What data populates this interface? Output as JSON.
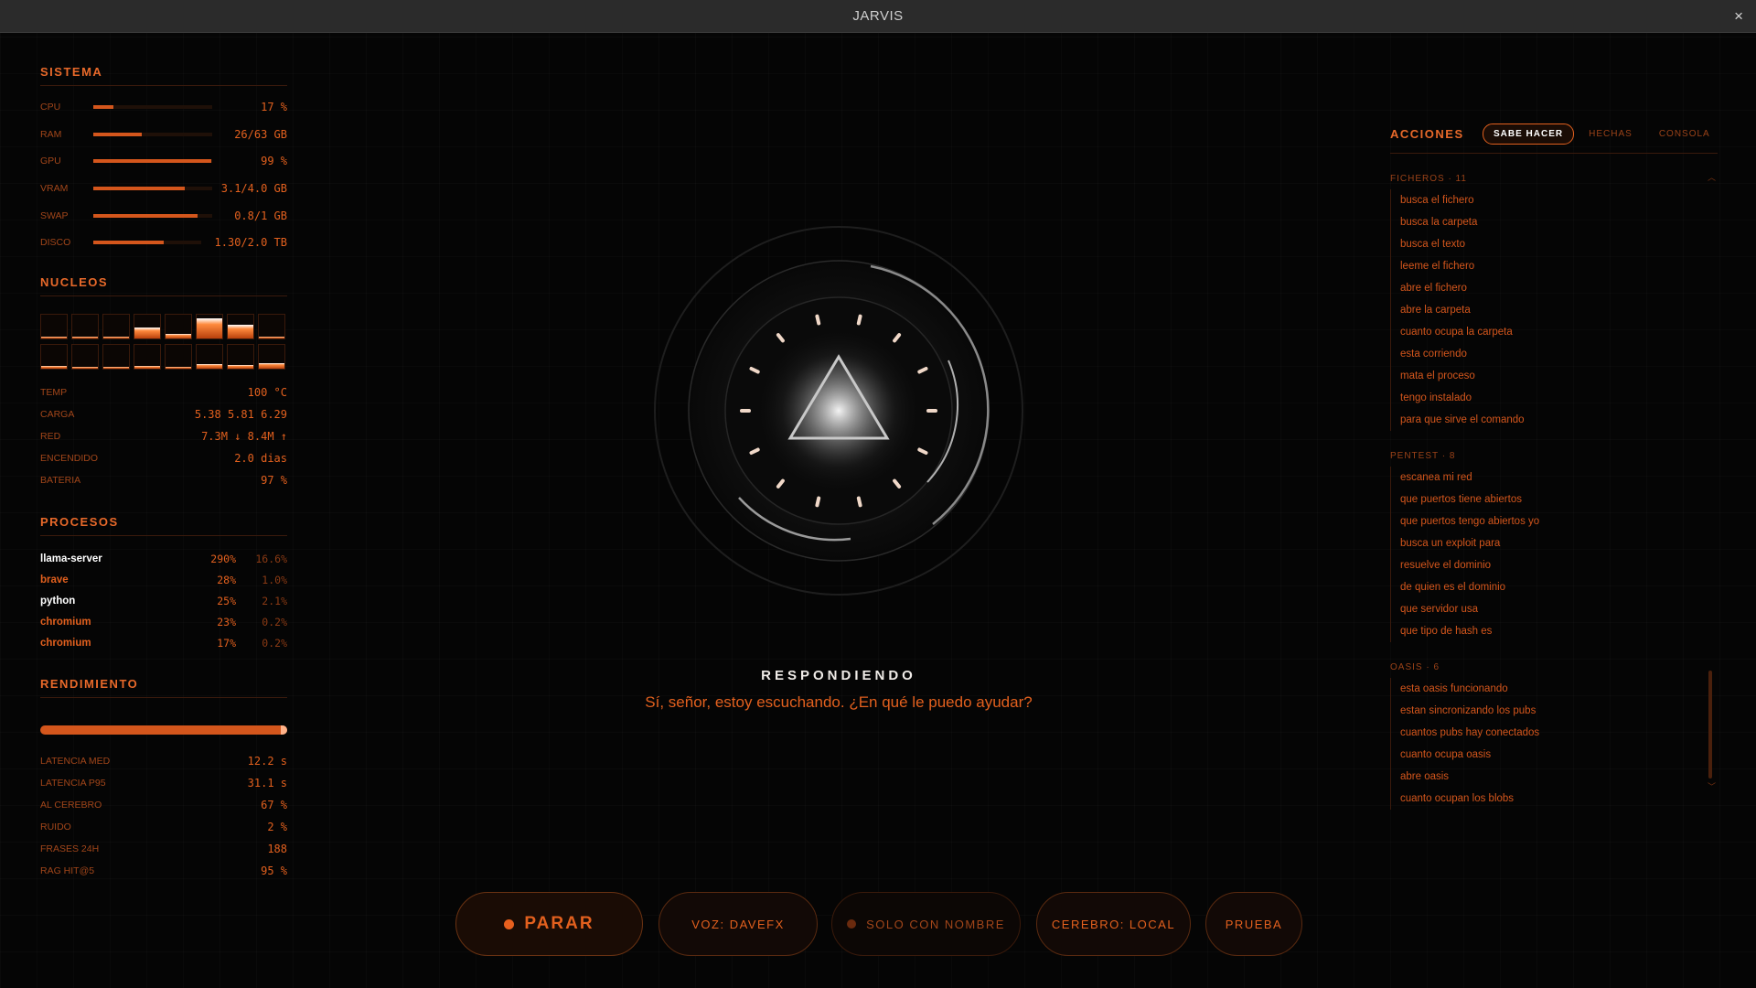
{
  "window": {
    "title": "JARVIS",
    "close_glyph": "×"
  },
  "sistema": {
    "heading": "SISTEMA",
    "metrics": [
      {
        "label": "CPU",
        "value": "17 %",
        "fill": 0.17
      },
      {
        "label": "RAM",
        "value": "26/63 GB",
        "fill": 0.41
      },
      {
        "label": "GPU",
        "value": "99 %",
        "fill": 0.99
      },
      {
        "label": "VRAM",
        "value": "3.1/4.0 GB",
        "fill": 0.77
      },
      {
        "label": "SWAP",
        "value": "0.8/1 GB",
        "fill": 0.88
      },
      {
        "label": "DISCO",
        "value": "1.30/2.0 TB",
        "fill": 0.65
      }
    ]
  },
  "nucleos": {
    "heading": "NUCLEOS",
    "cores": [
      0.08,
      0.05,
      0.06,
      0.45,
      0.18,
      0.85,
      0.6,
      0.07,
      0.12,
      0.08,
      0.1,
      0.12,
      0.1,
      0.2,
      0.15,
      0.22
    ],
    "stats": [
      {
        "label": "TEMP",
        "value": "100 °C"
      },
      {
        "label": "CARGA",
        "value": "5.38 5.81 6.29"
      },
      {
        "label": "RED",
        "value": "7.3M ↓ 8.4M ↑"
      },
      {
        "label": "ENCENDIDO",
        "value": "2.0 dias"
      },
      {
        "label": "BATERIA",
        "value": "97 %"
      }
    ]
  },
  "procesos": {
    "heading": "PROCESOS",
    "rows": [
      {
        "name": "llama-server",
        "cpu": "290%",
        "mem": "16.6%",
        "color": "#ffffff"
      },
      {
        "name": "brave",
        "cpu": "28%",
        "mem": "1.0%",
        "color": "#e2601e"
      },
      {
        "name": "python",
        "cpu": "25%",
        "mem": "2.1%",
        "color": "#ffffff"
      },
      {
        "name": "chromium",
        "cpu": "23%",
        "mem": "0.2%",
        "color": "#e2601e"
      },
      {
        "name": "chromium",
        "cpu": "17%",
        "mem": "0.2%",
        "color": "#e2601e"
      }
    ]
  },
  "rendimiento": {
    "heading": "RENDIMIENTO",
    "bar_level": 0.97,
    "stats": [
      {
        "label": "LATENCIA MED",
        "value": "12.2 s"
      },
      {
        "label": "LATENCIA P95",
        "value": "31.1 s"
      },
      {
        "label": "AL CEREBRO",
        "value": "67 %"
      },
      {
        "label": "RUIDO",
        "value": "2 %"
      },
      {
        "label": "FRASES 24H",
        "value": "188"
      },
      {
        "label": "RAG HIT@5",
        "value": "95 %"
      }
    ]
  },
  "center": {
    "status": "RESPONDIENDO",
    "reply": "Sí, señor, estoy escuchando. ¿En qué le puedo ayudar?"
  },
  "controls": {
    "parar": "PARAR",
    "voz": "VOZ: DAVEFX",
    "solo_nombre": "SOLO CON NOMBRE",
    "cerebro": "CEREBRO: LOCAL",
    "prueba": "PRUEBA"
  },
  "acciones": {
    "heading": "ACCIONES",
    "tabs": [
      "SABE HACER",
      "HECHAS",
      "CONSOLA"
    ],
    "groups": [
      {
        "title": "FICHEROS · 11",
        "items": [
          "busca el fichero",
          "busca la carpeta",
          "busca el texto",
          "leeme el fichero",
          "abre el fichero",
          "abre la carpeta",
          "cuanto ocupa la carpeta",
          "esta corriendo",
          "mata el proceso",
          "tengo instalado",
          "para que sirve el comando"
        ]
      },
      {
        "title": "PENTEST · 8",
        "items": [
          "escanea mi red",
          "que puertos tiene abiertos",
          "que puertos tengo abiertos yo",
          "busca un exploit para",
          "resuelve el dominio",
          "de quien es el dominio",
          "que servidor usa",
          "que tipo de hash es"
        ]
      },
      {
        "title": "OASIS · 6",
        "items": [
          "esta oasis funcionando",
          "estan sincronizando los pubs",
          "cuantos pubs hay conectados",
          "cuanto ocupa oasis",
          "abre oasis",
          "cuanto ocupan los blobs"
        ]
      }
    ]
  },
  "colors": {
    "accent": "#e2601e",
    "background": "#050505",
    "titlebar": "#2b2b2b"
  },
  "icons": {
    "close": "close-icon",
    "orb": "triangle-orb-icon",
    "scroll_up": "chevron-up-icon",
    "scroll_down": "chevron-down-icon"
  }
}
